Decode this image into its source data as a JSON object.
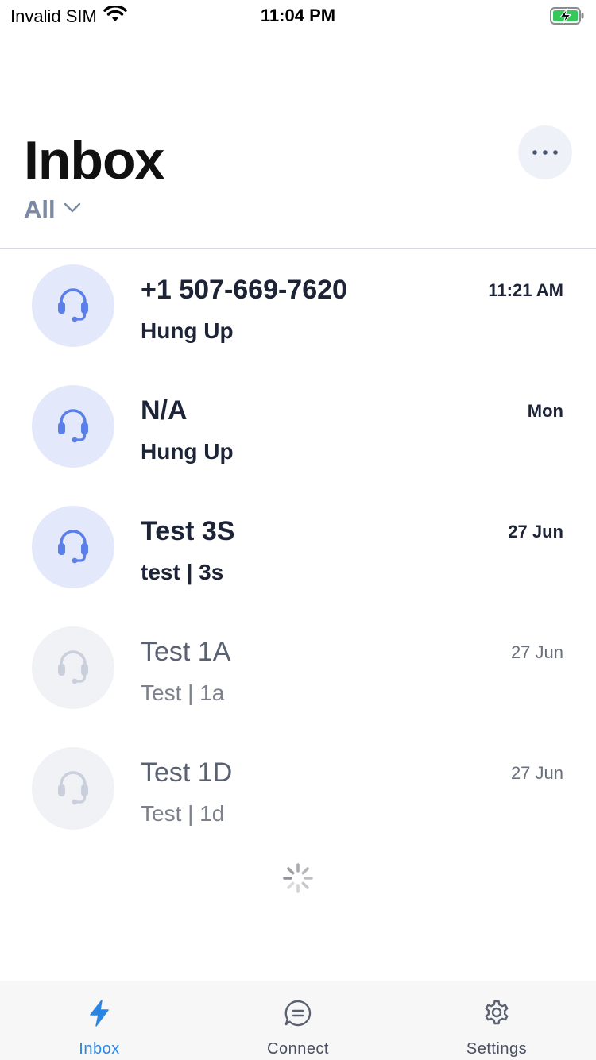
{
  "status_bar": {
    "carrier": "Invalid SIM",
    "time": "11:04 PM"
  },
  "header": {
    "title": "Inbox",
    "filter_label": "All"
  },
  "conversations": [
    {
      "name": "+1 507-669-7620",
      "subtitle": "Hung Up",
      "time": "11:21 AM",
      "unread": true,
      "icon": "headset-icon"
    },
    {
      "name": "N/A",
      "subtitle": "Hung Up",
      "time": "Mon",
      "unread": true,
      "icon": "headset-icon"
    },
    {
      "name": "Test 3S",
      "subtitle": "test | 3s",
      "time": "27 Jun",
      "unread": true,
      "icon": "headset-icon"
    },
    {
      "name": "Test 1A",
      "subtitle": "Test | 1a",
      "time": "27 Jun",
      "unread": false,
      "icon": "headset-icon"
    },
    {
      "name": "Test 1D",
      "subtitle": "Test | 1d",
      "time": "27 Jun",
      "unread": false,
      "icon": "headset-icon"
    }
  ],
  "tab_bar": {
    "tabs": [
      {
        "label": "Inbox",
        "icon": "bolt-icon",
        "active": true
      },
      {
        "label": "Connect",
        "icon": "chat-bubble-icon",
        "active": false
      },
      {
        "label": "Settings",
        "icon": "gear-icon",
        "active": false
      }
    ]
  },
  "colors": {
    "accent": "#2a86e4",
    "avatar_active_bg": "#e3e9fb",
    "avatar_active_icon": "#5b7fe8",
    "avatar_read_bg": "#f0f2f6",
    "avatar_read_icon": "#c9cfdb",
    "battery_green": "#34c759"
  }
}
